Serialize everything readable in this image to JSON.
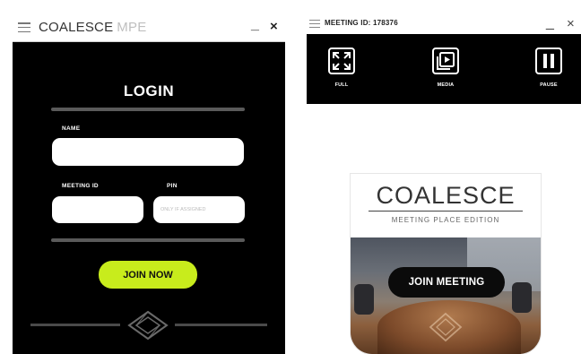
{
  "login_window": {
    "brand": "COALESCE",
    "brand_sub": "MPE",
    "minimize": "_",
    "close": "×",
    "heading": "LOGIN",
    "name_label": "NAME",
    "name_value": "",
    "meeting_id_label": "MEETING ID",
    "meeting_id_value": "",
    "pin_label": "PIN",
    "pin_placeholder": "ONLY IF ASSIGNED",
    "join_button": "JOIN NOW",
    "accent_color": "#c8ec1c"
  },
  "toolbar_window": {
    "title": "MEETING ID: 178376",
    "minimize": "_",
    "close": "×",
    "tools": [
      {
        "label": "FULL",
        "icon": "fullscreen-icon"
      },
      {
        "label": "MEDIA",
        "icon": "media-icon"
      },
      {
        "label": "PAUSE",
        "icon": "pause-icon"
      }
    ]
  },
  "app_tile": {
    "brand": "COALESCE",
    "subtitle": "MEETING PLACE EDITION",
    "join_button": "JOIN MEETING"
  }
}
